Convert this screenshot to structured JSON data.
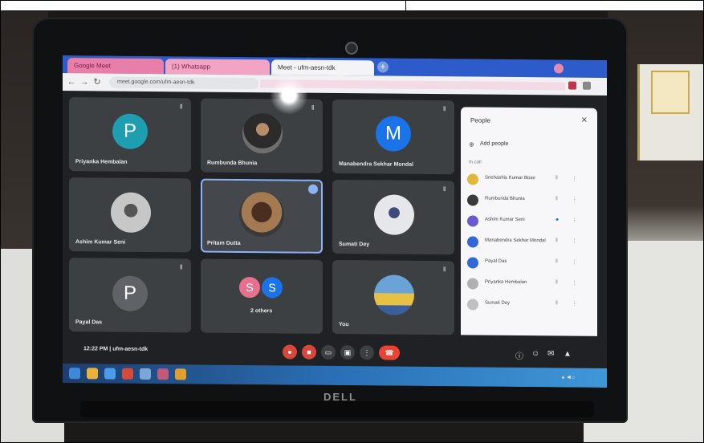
{
  "brand": "DELL",
  "browser": {
    "tabs": [
      {
        "label": "Google Meet"
      },
      {
        "label": "(1) Whatsapp"
      },
      {
        "label": "Meet - ufm-aesn-tdk"
      }
    ],
    "address": "meet.google.com/ufm-aesn-tdk"
  },
  "meet": {
    "tiles": [
      {
        "name": "Priyanka Hembalan",
        "initial": "P",
        "color": "#1e9eb0",
        "kind": "initial"
      },
      {
        "name": "Rumbunda Bhunia",
        "kind": "photo",
        "style": "dark"
      },
      {
        "name": "Manabendra Sekhar Mondal",
        "initial": "M",
        "color": "#1a73e8",
        "kind": "initial"
      },
      {
        "name": "Ashim Kumar Seni",
        "kind": "photo",
        "style": "grey"
      },
      {
        "name": "Pritam Dutta",
        "kind": "photo",
        "style": "brown"
      },
      {
        "name": "Sumati Dey",
        "kind": "photo",
        "style": "light"
      },
      {
        "name": "Payal Das",
        "initial": "P",
        "color": "#5f6368",
        "kind": "initial"
      },
      {
        "name": "2 others",
        "kind": "others",
        "initials": [
          "S",
          "S"
        ],
        "colors": [
          "#e8708f",
          "#1a73e8"
        ]
      },
      {
        "name": "You",
        "kind": "photo",
        "style": "land"
      }
    ],
    "time": "12:22 PM",
    "meeting_code": "ufm-aesn-tdk"
  },
  "people_panel": {
    "title": "People",
    "add_label": "Add people",
    "in_call_label": "In call",
    "participants": [
      {
        "name": "Snehashis Kumar Bose",
        "color": "#e0b83d"
      },
      {
        "name": "Rumbunda Bhunia",
        "color": "#3a3a3a"
      },
      {
        "name": "Ashim Kumar Seni",
        "color": "#6a5acd"
      },
      {
        "name": "Manabendra Sekhar Mondal",
        "color": "#3367d6"
      },
      {
        "name": "Payal Das",
        "color": "#3367d6"
      },
      {
        "name": "Priyanka Hembalan",
        "color": "#b0b0b0"
      },
      {
        "name": "Sumati Dey",
        "color": "#c0c0c0"
      }
    ]
  }
}
